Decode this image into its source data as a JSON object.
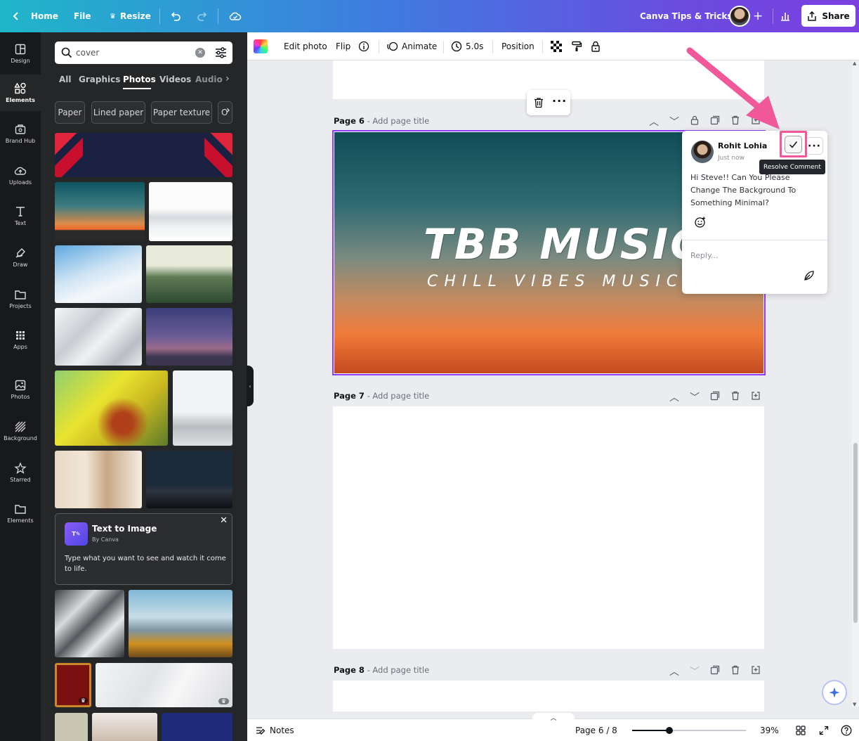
{
  "topbar": {
    "home": "Home",
    "file": "File",
    "resize": "Resize",
    "project_title": "Canva Tips & Tricks",
    "share": "Share"
  },
  "rail": [
    {
      "label": "Design",
      "icon": "design-icon"
    },
    {
      "label": "Elements",
      "icon": "elements-icon"
    },
    {
      "label": "Brand Hub",
      "icon": "brand-hub-icon"
    },
    {
      "label": "Uploads",
      "icon": "uploads-icon"
    },
    {
      "label": "Text",
      "icon": "text-icon"
    },
    {
      "label": "Draw",
      "icon": "draw-icon"
    },
    {
      "label": "Projects",
      "icon": "projects-icon"
    },
    {
      "label": "Apps",
      "icon": "apps-icon"
    },
    {
      "label": "Photos",
      "icon": "photos-icon"
    },
    {
      "label": "Background",
      "icon": "background-icon"
    },
    {
      "label": "Starred",
      "icon": "starred-icon"
    },
    {
      "label": "Elements",
      "icon": "folder-icon"
    }
  ],
  "panel": {
    "search_value": "cover",
    "tabs": [
      "All",
      "Graphics",
      "Photos",
      "Videos",
      "Audio"
    ],
    "active_tab": "Photos",
    "chips": [
      "Paper",
      "Lined paper",
      "Paper texture",
      "O"
    ],
    "text_to_image": {
      "title": "Text to Image",
      "by": "By Canva",
      "description": "Type what you want to see and watch it come to life."
    }
  },
  "context_toolbar": {
    "edit_photo": "Edit photo",
    "flip": "Flip",
    "animate": "Animate",
    "duration": "5.0s",
    "position": "Position"
  },
  "pages": {
    "page6": {
      "number": "Page 6",
      "title_placeholder": "Add page title"
    },
    "page7": {
      "number": "Page 7",
      "title_placeholder": "Add page title"
    },
    "page8": {
      "number": "Page 8",
      "title_placeholder": "Add page title"
    }
  },
  "design": {
    "headline": "TBB MUSIC",
    "subheadline": "CHILL VIBES MUSIC"
  },
  "comment": {
    "author": "Rohit Lohia",
    "time": "Just now",
    "text": "Hi Steve!! Can You Please Change The Background To Something Minimal?",
    "tooltip": "Resolve Comment",
    "reply_placeholder": "Reply..."
  },
  "bottombar": {
    "notes": "Notes",
    "page_indicator": "Page 6 / 8",
    "zoom": "39%",
    "zoom_fraction": 0.33
  },
  "colors": {
    "accent_purple": "#8b3dff",
    "annotation_pink": "#f0589a",
    "panel_bg": "#252627",
    "rail_bg": "#18191b"
  }
}
